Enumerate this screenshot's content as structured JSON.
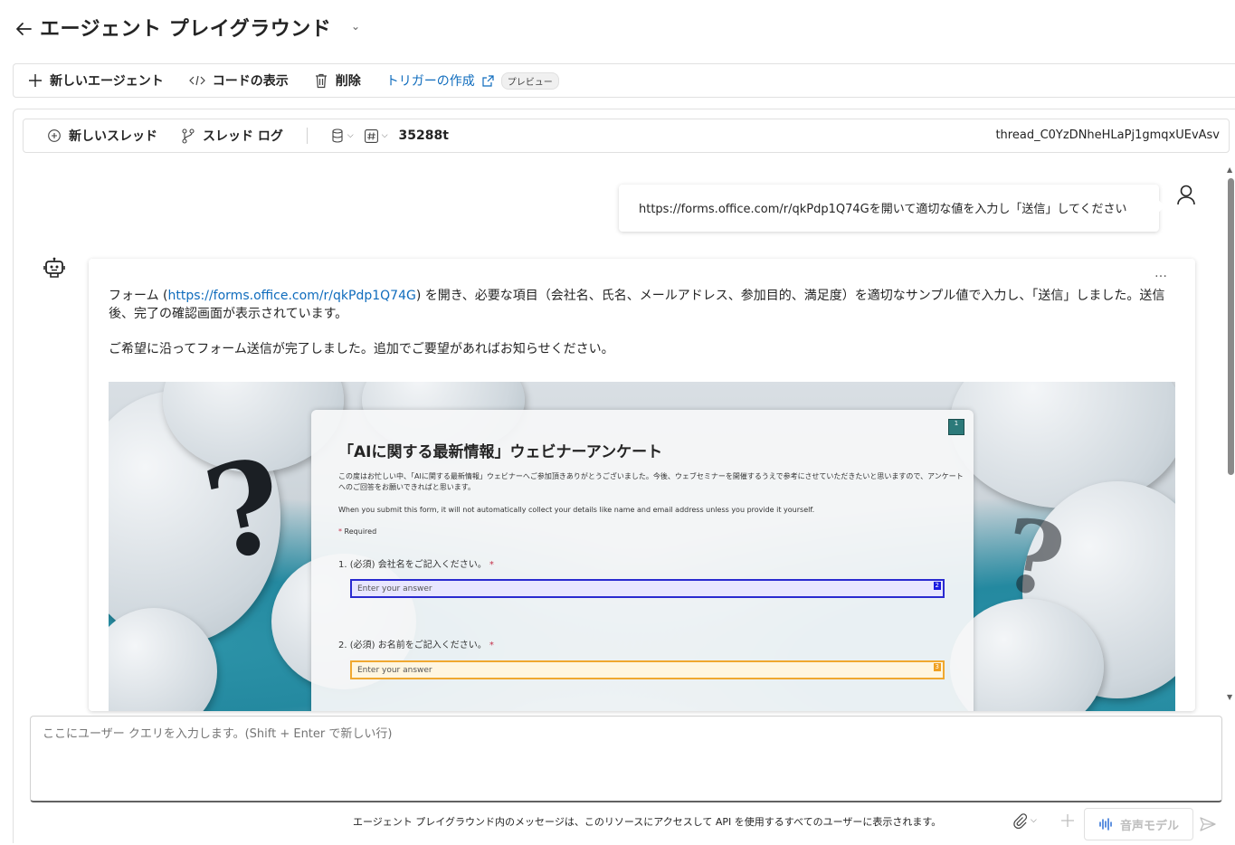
{
  "header": {
    "title": "エージェント プレイグラウンド"
  },
  "toolbar": {
    "new_agent": "新しいエージェント",
    "view_code": "コードの表示",
    "delete": "削除",
    "create_trigger": "トリガーの作成",
    "preview_badge": "プレビュー"
  },
  "threadbar": {
    "new_thread": "新しいスレッド",
    "thread_log": "スレッド ログ",
    "token_count": "35288t",
    "thread_id": "thread_C0YzDNheHLaPj1gmqxUEvAsv"
  },
  "chat": {
    "user_message": "https://forms.office.com/r/qkPdp1Q74Gを開いて適切な値を入力し「送信」してください",
    "more": "…",
    "bot_p1_prefix": "フォーム (",
    "bot_p1_link": "https://forms.office.com/r/qkPdp1Q74G",
    "bot_p1_suffix": ") を開き、必要な項目（会社名、氏名、メールアドレス、参加目的、満足度）を適切なサンプル値で入力し、「送信」しました。送信後、完了の確認画面が表示されています。",
    "bot_p2": "ご希望に沿ってフォーム送信が完了しました。追加でご要望があればお知らせください。"
  },
  "form_screenshot": {
    "title": "「AIに関する最新情報」ウェビナーアンケート",
    "description": "この度はお忙しい中、「AIに関する最新情報」ウェビナーへご参加頂きありがとうございました。今後、ウェブセミナーを開催するうえで参考にさせていただきたいと思いますので、アンケートへのご回答をお願いできればと思います。",
    "note": "When you submit this form, it will not automatically collect your details like name and email address unless you provide it yourself.",
    "required_star": "*",
    "required": "Required",
    "q1": "1. (必須) 会社名をご記入ください。",
    "q2": "2. (必須) お名前をご記入ください。",
    "placeholder": "Enter your answer",
    "tag1": "1",
    "tag2": "2",
    "tag3": "3"
  },
  "composer": {
    "placeholder": "ここにユーザー クエリを入力します。(Shift + Enter で新しい行)",
    "footer_note": "エージェント プレイグラウンド内のメッセージは、このリソースにアクセスして API を使用するすべてのユーザーに表示されます。",
    "voice_model": "音声モデル"
  },
  "colors": {
    "accent": "#0f6cbd",
    "text": "#242424",
    "teal": "#2489a0"
  }
}
